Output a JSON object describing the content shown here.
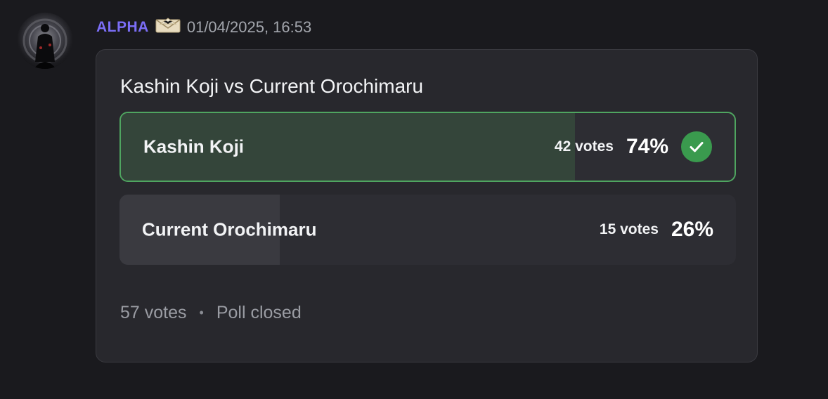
{
  "message": {
    "author": {
      "name": "ALPHA",
      "name_color": "#7b6ef6",
      "avatar_icon": "shadow-figure-avatar",
      "role_icon": "envelope-bat-icon"
    },
    "timestamp": "01/04/2025, 16:53"
  },
  "poll": {
    "question": "Kashin Koji vs Current Orochimaru",
    "answers": [
      {
        "label": "Kashin Koji",
        "votes_text": "42 votes",
        "percent_text": "74%",
        "fraction": 0.74,
        "winner": true,
        "fill_color": "#34453a",
        "icon": "check-circle-icon"
      },
      {
        "label": "Current Orochimaru",
        "votes_text": "15 votes",
        "percent_text": "26%",
        "fraction": 0.26,
        "winner": false,
        "fill_color": "#3a3a40"
      }
    ],
    "total_votes": "57 votes",
    "separator": "•",
    "status": "Poll closed"
  },
  "colors": {
    "background": "#1a1a1e",
    "card": "#28282d",
    "winner_border": "#4fa560",
    "check": "#3a9a4e"
  }
}
